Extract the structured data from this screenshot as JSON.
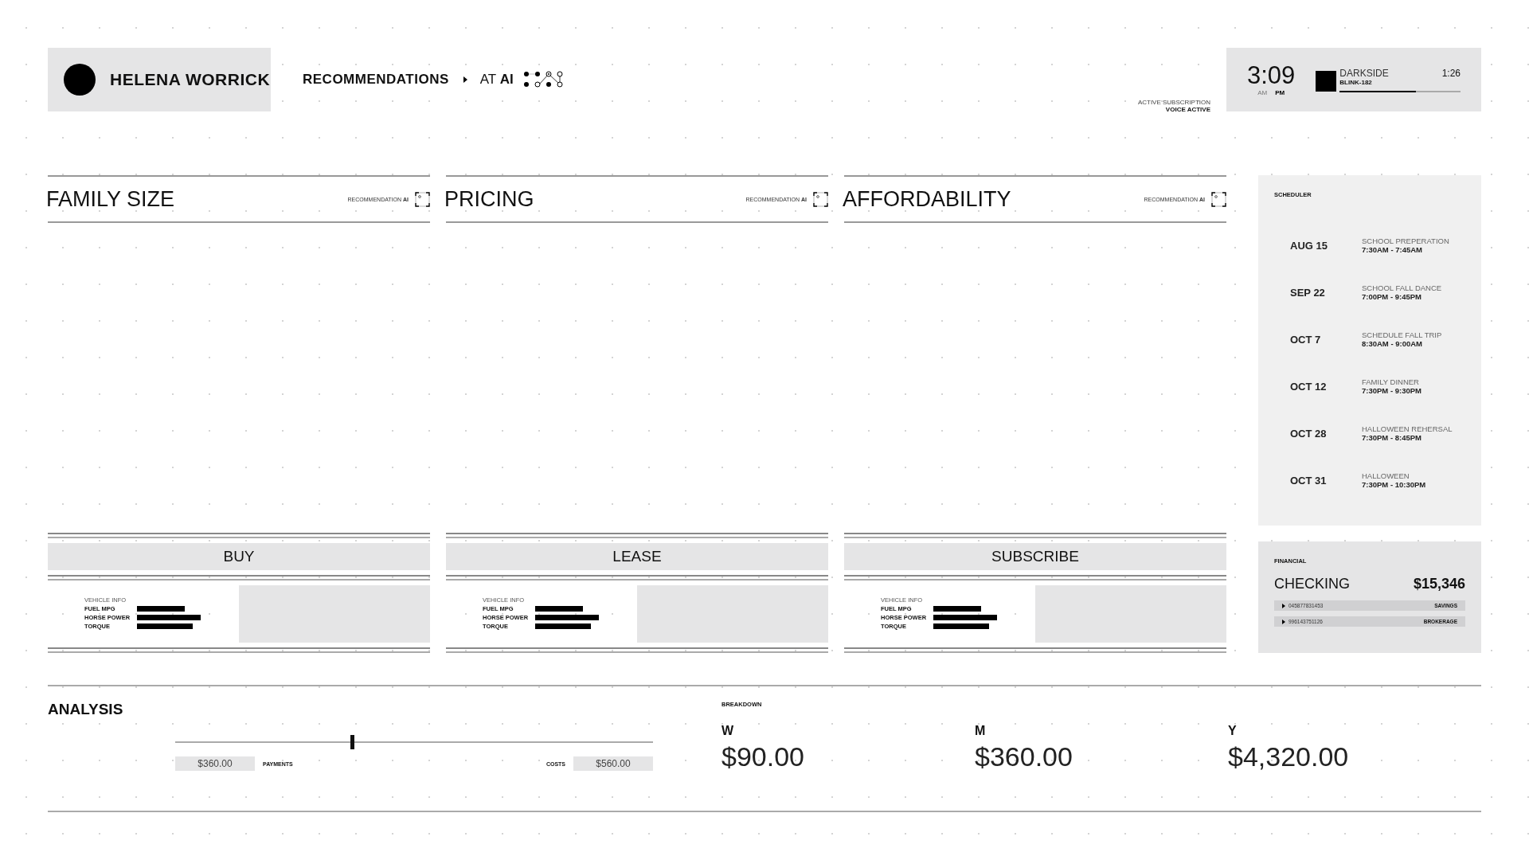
{
  "user": {
    "name": "HELENA WORRICK"
  },
  "breadcrumb": {
    "section": "RECOMMENDATIONS",
    "context": "AT **AI**"
  },
  "subscription": {
    "label": "ACTIVE SUBSCRIPTION",
    "status": "VOICE ACTIVE"
  },
  "clock": {
    "time": "3:09",
    "periods": [
      {
        "label": "AM",
        "selected": false
      },
      {
        "label": "PM",
        "selected": true
      }
    ]
  },
  "now_playing": {
    "title": "DARKSIDE",
    "artist": "BLINK-182",
    "elapsed": "1:26",
    "level": 0.63
  },
  "panels": [
    {
      "title": "FAMILY SIZE",
      "tag": "RECOMMENDATION **AI**",
      "action": "BUY",
      "vehicle_info": {
        "heading": "VEHICLE INFO",
        "specs": [
          {
            "label": "FUEL MPG"
          },
          {
            "label": "HORSE POWER"
          },
          {
            "label": "TORQUE"
          }
        ]
      }
    },
    {
      "title": "PRICING",
      "tag": "RECOMMENDATION **AI**",
      "action": "LEASE",
      "vehicle_info": {
        "heading": "VEHICLE INFO",
        "specs": [
          {
            "label": "FUEL MPG"
          },
          {
            "label": "HORSE POWER"
          },
          {
            "label": "TORQUE"
          }
        ]
      }
    },
    {
      "title": "AFFORDABILITY",
      "tag": "RECOMMENDATION **AI**",
      "action": "SUBSCRIBE",
      "vehicle_info": {
        "heading": "VEHICLE INFO",
        "specs": [
          {
            "label": "FUEL MPG"
          },
          {
            "label": "HORSE POWER"
          },
          {
            "label": "TORQUE"
          }
        ]
      }
    }
  ],
  "scheduler": {
    "title": "SCHEDULER",
    "events": [
      {
        "date": "AUG 15",
        "name": "SCHOOL PREPERATION",
        "time": "7:30AM - 7:45AM"
      },
      {
        "date": "SEP 22",
        "name": "SCHOOL FALL DANCE",
        "time": "7:00PM - 9:45PM"
      },
      {
        "date": "OCT 7",
        "name": "SCHEDULE FALL TRIP",
        "time": "8:30AM - 9:00AM"
      },
      {
        "date": "OCT 12",
        "name": "FAMILY DINNER",
        "time": "7:30PM - 9:30PM"
      },
      {
        "date": "OCT 28",
        "name": "HALLOWEEN REHERSAL",
        "time": "7:30PM - 8:45PM"
      },
      {
        "date": "OCT 31",
        "name": "HALLOWEEN",
        "time": "7:30PM - 10:30PM"
      }
    ]
  },
  "financial": {
    "title": "FINANCIAL",
    "account": "CHECKING",
    "balance": "$15,346",
    "accounts": [
      {
        "number": "045877831453",
        "type": "SAVINGS"
      },
      {
        "number": "996143751126",
        "type": "BROKERAGE"
      }
    ]
  },
  "analysis": {
    "title": "ANALYSIS",
    "slider": {
      "level": 0.37
    },
    "payments": {
      "value": "$360.00",
      "label": "PAYMENTS"
    },
    "costs": {
      "label": "COSTS",
      "value": "$560.00"
    },
    "breakdown": {
      "title": "BREAKDOWN",
      "periods": [
        {
          "label": "W",
          "amount": "$90.00"
        },
        {
          "label": "M",
          "amount": "$360.00"
        },
        {
          "label": "Y",
          "amount": "$4,320.00"
        }
      ]
    }
  }
}
